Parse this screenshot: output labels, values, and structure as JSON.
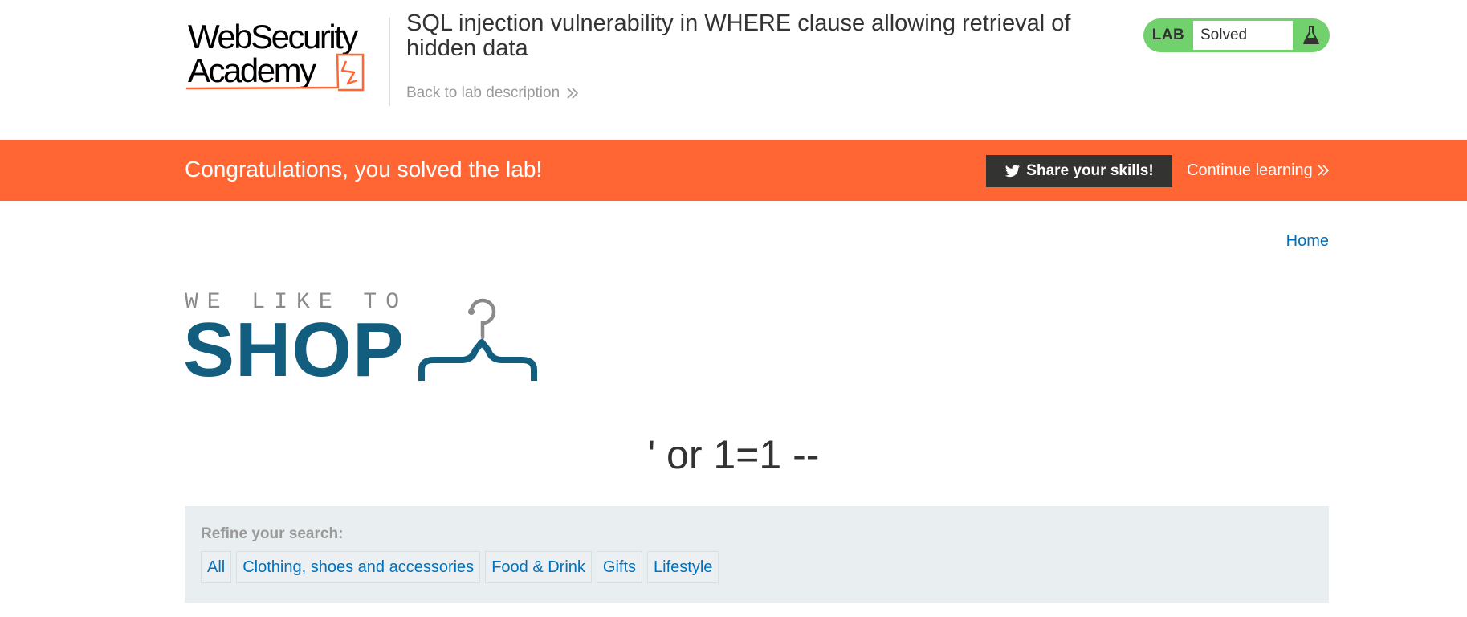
{
  "academy": {
    "logo_line1": "WebSecurity",
    "logo_line2": "Academy",
    "lab_title": "SQL injection vulnerability in WHERE clause allowing retrieval of hidden data",
    "back_link": "Back to lab description",
    "lab_badge": "LAB",
    "lab_status": "Solved",
    "colors": {
      "status_green": "#70d16d",
      "brand_orange": "#ff6633"
    }
  },
  "banner": {
    "message": "Congratulations, you solved the lab!",
    "share_label": "Share your skills!",
    "continue_label": "Continue learning"
  },
  "shop": {
    "home_link": "Home",
    "logo_tagline": "WE LIKE TO",
    "logo_word": "SHOP",
    "search_term": "' or 1=1 --",
    "colors": {
      "logo_blue": "#135e7f",
      "link_blue": "#0071bc"
    }
  },
  "filters": {
    "heading": "Refine your search:",
    "categories": [
      "All",
      "Clothing, shoes and accessories",
      "Food & Drink",
      "Gifts",
      "Lifestyle"
    ]
  },
  "icons": {
    "back_link": "double-chevron-right-icon",
    "lab_status": "flask-icon",
    "share_button": "twitter-bird-icon",
    "continue_link": "double-chevron-right-icon",
    "shop_logo": "clothes-hanger-icon"
  }
}
